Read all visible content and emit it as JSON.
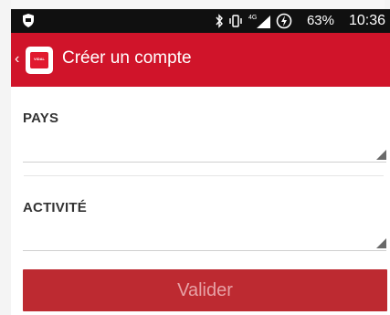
{
  "status_bar": {
    "battery": "63%",
    "time": "10:36",
    "network": "4G",
    "icons": [
      "shield-icon",
      "bluetooth-icon",
      "vibrate-icon",
      "signal-icon",
      "battery-icon"
    ]
  },
  "app_bar": {
    "title": "Créer un compte",
    "back_glyph": "‹",
    "logo_text": "VIDAL",
    "color": "#d0142a"
  },
  "form": {
    "country_label": "PAYS",
    "country_value": "",
    "activity_label": "ACTIVITÉ",
    "activity_value": "",
    "submit_label": "Valider",
    "submit_color": "#bd2a31"
  }
}
